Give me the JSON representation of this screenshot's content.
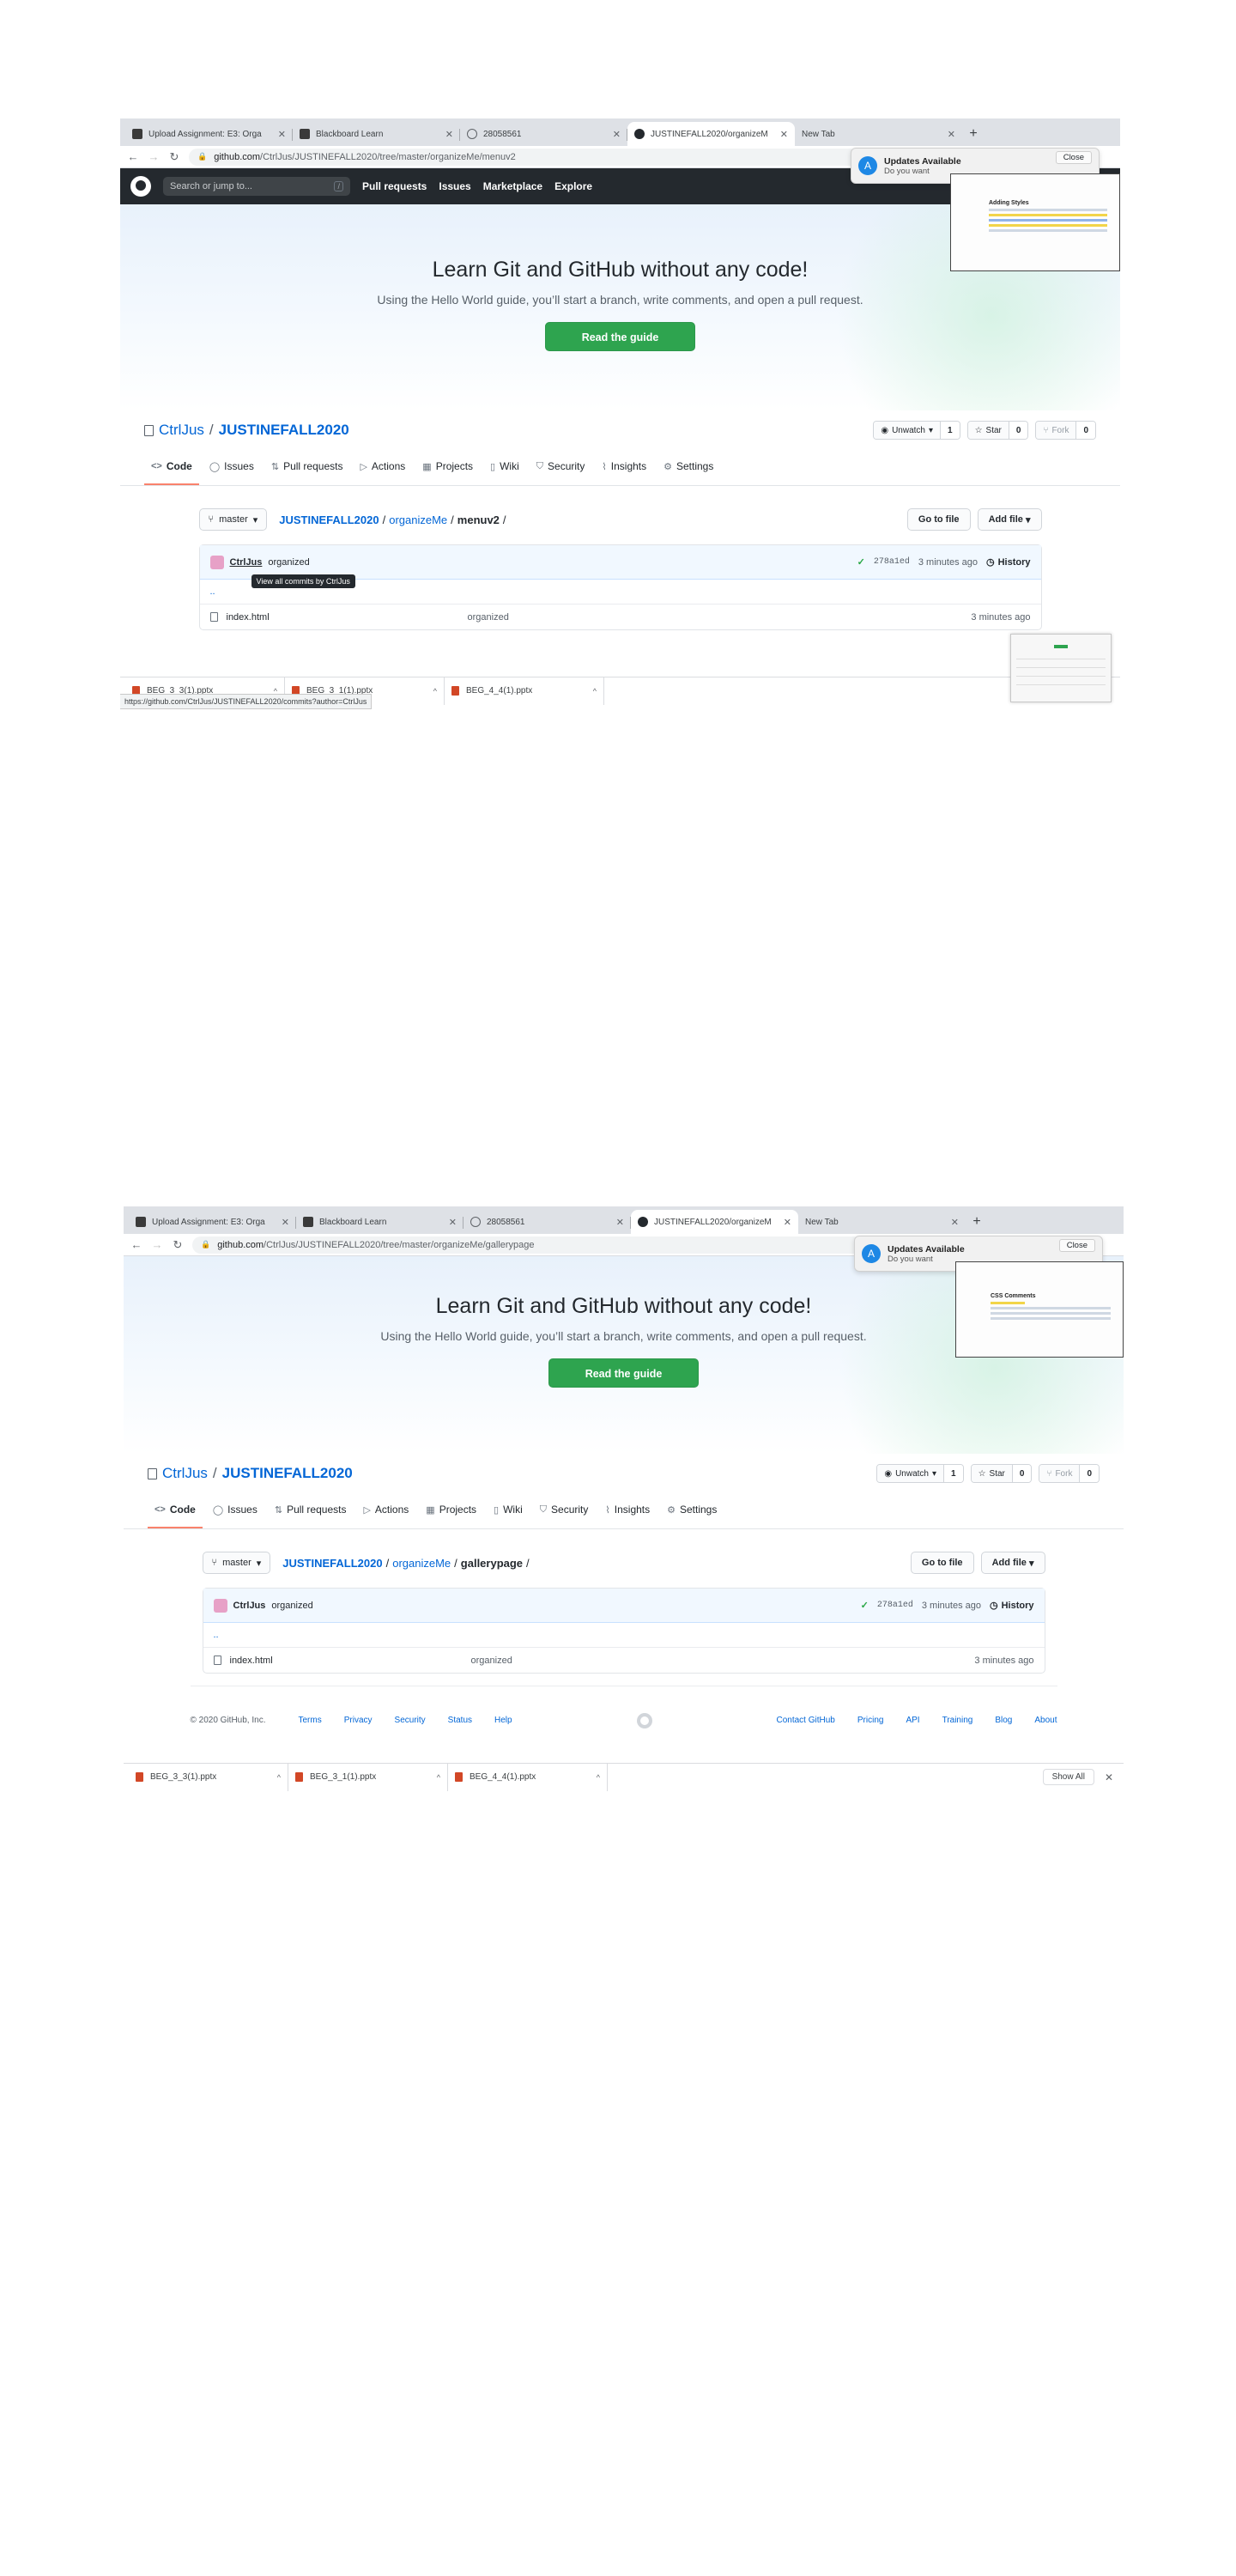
{
  "tabs": [
    {
      "title": "Upload Assignment: E3: Orga",
      "icon": "blackboard-icon"
    },
    {
      "title": "Blackboard Learn",
      "icon": "blackboard-icon"
    },
    {
      "title": "28058561",
      "icon": "globe-icon"
    },
    {
      "title": "JUSTINEFALL2020/organizeM",
      "icon": "github-icon"
    },
    {
      "title": "New Tab",
      "icon": ""
    }
  ],
  "header": {
    "search_placeholder": "Search or jump to...",
    "search_key": "/",
    "nav": [
      "Pull requests",
      "Issues",
      "Marketplace",
      "Explore"
    ]
  },
  "hero": {
    "title": "Learn Git and GitHub without any code!",
    "subtitle": "Using the Hello World guide, you’ll start a branch, write comments, and open a pull request.",
    "button": "Read the guide"
  },
  "repo": {
    "owner": "CtrlJus",
    "sep": "/",
    "name": "JUSTINEFALL2020",
    "watch_label": "Unwatch",
    "watch_count": "1",
    "star_label": "Star",
    "star_count": "0",
    "fork_label": "Fork",
    "fork_count": "0",
    "tabs": [
      "Code",
      "Issues",
      "Pull requests",
      "Actions",
      "Projects",
      "Wiki",
      "Security",
      "Insights",
      "Settings"
    ]
  },
  "popup": {
    "title": "Updates Available",
    "body": "Do you want",
    "close": "Close"
  },
  "branch": "master",
  "goto": "Go to file",
  "addfile": "Add file",
  "commit": {
    "author": "CtrlJus",
    "message": "organized",
    "sha": "278a1ed",
    "time": "3 minutes ago",
    "history": "History",
    "tooltip": "View all commits by CtrlJus"
  },
  "parent_dir": "..",
  "shots": [
    {
      "url_host": "github.com",
      "url_path": "/CtrlJus/JUSTINEFALL2020/tree/master/organizeMe/menuv2",
      "crumb_root": "JUSTINEFALL2020",
      "crumb_mid": "organizeMe",
      "crumb_cur": "menuv2",
      "file": {
        "name": "index.html",
        "message": "organized",
        "age": "3 minutes ago"
      },
      "status_url": "https://github.com/CtrlJus/JUSTINEFALL2020/commits?author=CtrlJus",
      "thumb_title": "Adding Styles"
    },
    {
      "url_host": "github.com",
      "url_path": "/CtrlJus/JUSTINEFALL2020/tree/master/organizeMe/gallerypage",
      "crumb_root": "JUSTINEFALL2020",
      "crumb_mid": "organizeMe",
      "crumb_cur": "gallerypage",
      "file": {
        "name": "index.html",
        "message": "organized",
        "age": "3 minutes ago"
      },
      "thumb_title": "CSS Comments"
    }
  ],
  "footer": {
    "copyright": "© 2020 GitHub, Inc.",
    "left_links": [
      "Terms",
      "Privacy",
      "Security",
      "Status",
      "Help"
    ],
    "right_links": [
      "Contact GitHub",
      "Pricing",
      "API",
      "Training",
      "Blog",
      "About"
    ]
  },
  "downloads": {
    "items": [
      "BEG_3_3(1).pptx",
      "BEG_3_1(1).pptx",
      "BEG_4_4(1).pptx"
    ],
    "show_all": "Show All"
  },
  "colors": {
    "accent_green": "#2ea44f",
    "link_blue": "#0366d6",
    "header_dark": "#24292e",
    "tab_underline": "#f9826c"
  }
}
